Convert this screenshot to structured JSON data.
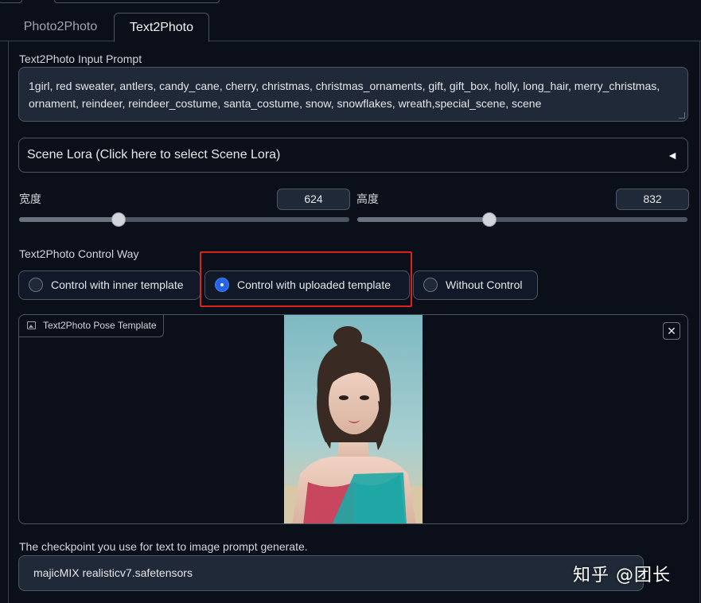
{
  "tabs": [
    {
      "label": "Photo2Photo",
      "active": false
    },
    {
      "label": "Text2Photo",
      "active": true
    }
  ],
  "prompt": {
    "label": "Text2Photo Input Prompt",
    "value": "1girl, red sweater, antlers, candy_cane, cherry, christmas, christmas_ornaments, gift, gift_box, holly, long_hair, merry_christmas, ornament, reindeer, reindeer_costume, santa_costume, snow, snowflakes, wreath,special_scene, scene"
  },
  "scene_lora": {
    "label": "Scene Lora (Click here to select Scene Lora)",
    "arrow": "◄"
  },
  "width": {
    "label": "宽度",
    "value": "624",
    "min": 0,
    "max": 2048,
    "fraction": 0.3
  },
  "height": {
    "label": "高度",
    "value": "832",
    "min": 0,
    "max": 2048,
    "fraction": 0.4
  },
  "control_way": {
    "label": "Text2Photo Control Way",
    "options": [
      {
        "label": "Control with inner template",
        "selected": false
      },
      {
        "label": "Control with uploaded template",
        "selected": true
      },
      {
        "label": "Without Control",
        "selected": false
      }
    ]
  },
  "pose_template": {
    "label": "Text2Photo Pose Template",
    "close": "✕"
  },
  "checkpoint": {
    "label": "The checkpoint you use for text to image prompt generate.",
    "value": "majicMIX realisticv7.safetensors"
  },
  "watermark": "知乎 @团长",
  "colors": {
    "background": "#0b0f19",
    "border": "#4b5563",
    "highlight": "#d8231f",
    "radio_selected": "#2563eb"
  }
}
